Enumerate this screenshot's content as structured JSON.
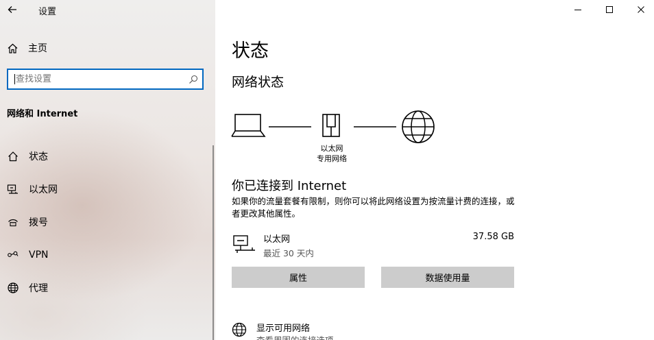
{
  "window": {
    "title": "设置",
    "minimize_glyph": "—",
    "maximize_glyph": "☐",
    "close_glyph": "✕"
  },
  "sidebar": {
    "home_label": "主页",
    "search_placeholder": "查找设置",
    "section_title": "网络和 Internet",
    "items": [
      {
        "label": "状态",
        "icon": "status-home-icon"
      },
      {
        "label": "以太网",
        "icon": "ethernet-icon"
      },
      {
        "label": "拨号",
        "icon": "dialup-icon"
      },
      {
        "label": "VPN",
        "icon": "vpn-icon"
      },
      {
        "label": "代理",
        "icon": "globe-icon"
      }
    ]
  },
  "main": {
    "title": "状态",
    "subtitle": "网络状态",
    "diagram": {
      "adapter_label_1": "以太网",
      "adapter_label_2": "专用网络"
    },
    "connected_text": "你已连接到 Internet",
    "description": "如果你的流量套餐有限制，则你可以将此网络设置为按流量计费的连接，或者更改其他属性。",
    "network": {
      "name": "以太网",
      "period": "最近 30 天内",
      "usage": "37.58 GB"
    },
    "buttons": {
      "properties": "属性",
      "data_usage": "数据使用量"
    },
    "show_networks": {
      "title": "显示可用网络",
      "subtitle": "查看周围的连接选项"
    }
  }
}
